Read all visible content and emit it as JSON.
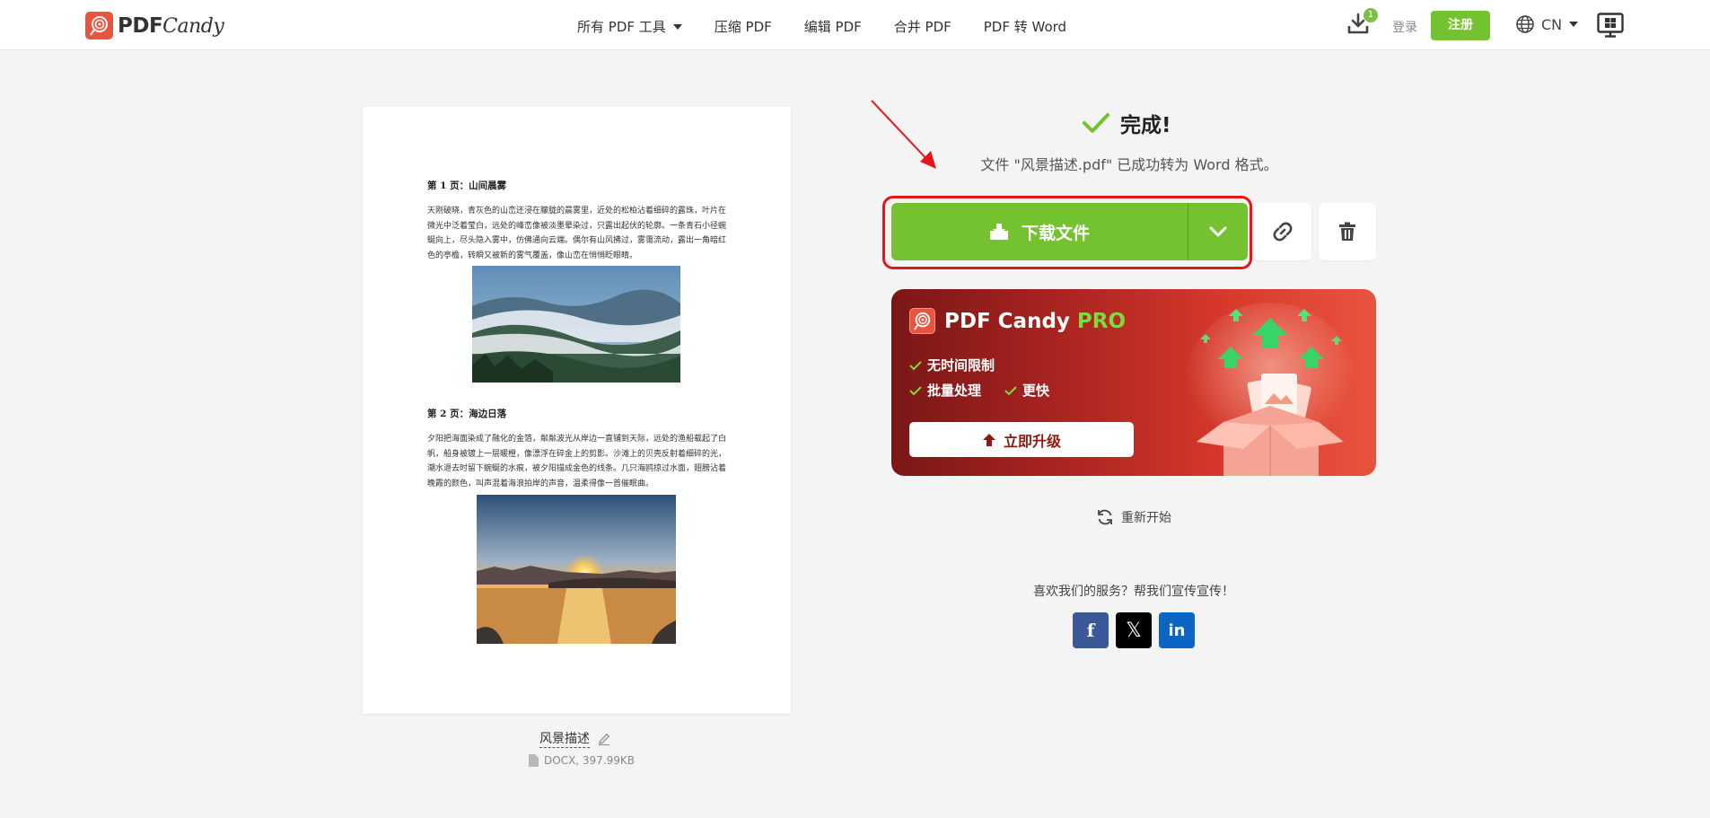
{
  "header": {
    "logo_pdf": "PDF",
    "logo_candy": "Candy",
    "nav": [
      "所有 PDF 工具",
      "压缩 PDF",
      "编辑 PDF",
      "合并 PDF",
      "PDF 转 Word"
    ],
    "download_badge": "1",
    "login": "登录",
    "register": "注册",
    "language": "CN"
  },
  "preview": {
    "page1_heading": "第 1 页：山间晨雾",
    "page1_text": "天刚破晓，青灰色的山峦还浸在朦胧的晨雾里，近处的松柏沾着细碎的露珠，叶片在微光中泛着莹白，远处的峰峦像被淡墨晕染过，只露出起伏的轮廓。一条青石小径蜿蜒向上，尽头隐入雾中，仿佛通向云端。偶尔有山风拂过，雾霭流动，露出一角暗红色的亭檐，转瞬又被新的雾气覆盖，像山峦在悄悄眨眼睛。",
    "page2_heading": "第 2 页：海边日落",
    "page2_text": "夕阳把海面染成了融化的金箔，粼粼波光从岸边一直铺到天际，远处的渔船载起了白帆，船身被镀上一层暖橙，像漂浮在碎金上的剪影。沙滩上的贝壳反射着细碎的光，潮水退去时留下蜿蜒的水痕，被夕阳描成金色的线条。几只海鸥掠过水面，翅膀沾着晚霞的颜色，叫声混着海浪拍岸的声音，温柔得像一首催眠曲。",
    "file_name": "风景描述",
    "file_meta": "DOCX, 397.99KB"
  },
  "result": {
    "done_title": "完成!",
    "done_message": "文件 \"风景描述.pdf\" 已成功转为 Word 格式。",
    "download_label": "下载文件"
  },
  "pro": {
    "brand": "PDF Candy",
    "pro_word": "PRO",
    "features": [
      "无时间限制",
      "批量处理",
      "更快"
    ],
    "upgrade_label": "立即升级"
  },
  "restart_label": "重新开始",
  "share_text": "喜欢我们的服务？帮我们宣传宣传！",
  "social": [
    "f",
    "𝕏",
    "in"
  ],
  "colors": {
    "accent_green": "#74c22f",
    "highlight_red": "#e7141a",
    "brand_orange": "#e8543f"
  }
}
